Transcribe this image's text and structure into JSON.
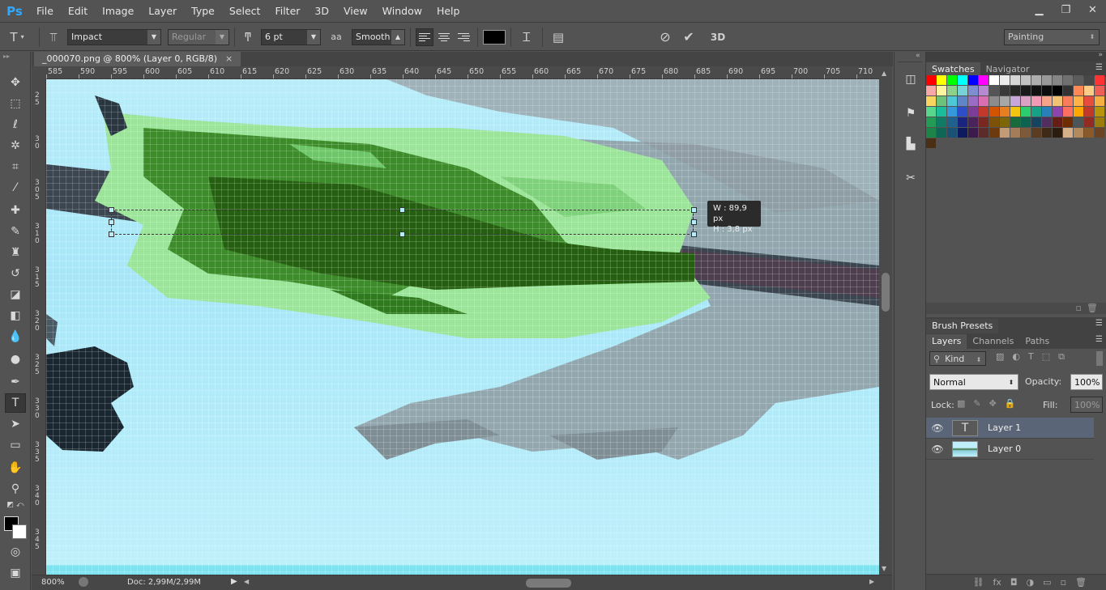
{
  "menu": {
    "logo": "Ps",
    "items": [
      "File",
      "Edit",
      "Image",
      "Layer",
      "Type",
      "Select",
      "Filter",
      "3D",
      "View",
      "Window",
      "Help"
    ]
  },
  "window_controls": [
    "minimize-icon",
    "restore-icon",
    "close-icon"
  ],
  "options": {
    "font_family": "Impact",
    "font_style": "Regular",
    "font_size": "6 pt",
    "anti_alias_icon": "aa",
    "anti_alias": "Smooth",
    "threed_label": "3D",
    "workspace": "Painting"
  },
  "document": {
    "tab_title": "_000070.png @ 800% (Layer 0, RGB/8)",
    "close": "×",
    "ruler_top_labels": [
      "585",
      "590",
      "595",
      "600",
      "605",
      "610",
      "615",
      "620",
      "625",
      "630",
      "635",
      "640",
      "645",
      "650",
      "655",
      "660",
      "665",
      "670",
      "675",
      "680",
      "685",
      "690",
      "695",
      "700",
      "705",
      "710"
    ],
    "ruler_left_labels": [
      "25",
      "30",
      "305",
      "310",
      "315",
      "320",
      "325",
      "330",
      "335",
      "340",
      "345"
    ],
    "transform_info": {
      "w": "W :  89,9 px",
      "h": "H :   3,8 px"
    }
  },
  "status": {
    "zoom": "800%",
    "doc_info": "Doc: 2,99M/2,99M"
  },
  "swatches_panel": {
    "tabs": [
      "Swatches",
      "Navigator"
    ],
    "colors": [
      "#ff0000",
      "#ffff00",
      "#00ff00",
      "#00ffff",
      "#0000ff",
      "#ff00ff",
      "#ffffff",
      "#ebebeb",
      "#d6d6d6",
      "#c2c2c2",
      "#adadad",
      "#999999",
      "#858585",
      "#707070",
      "#5c5c5c",
      "#474747",
      "#ff3333",
      "#f9a8a8",
      "#fff59e",
      "#8ed18a",
      "#77d1d6",
      "#7e8fd1",
      "#b58ad1",
      "#555555",
      "#3a3a3a",
      "#262626",
      "#1a1a1a",
      "#111111",
      "#0d0d0d",
      "#000000",
      "#333333",
      "#ff8855",
      "#ffcc88",
      "#ee5f55",
      "#f7d55e",
      "#6cc27a",
      "#4dc7d3",
      "#5f84c7",
      "#9b6cc3",
      "#d96fb0",
      "#8c8c8c",
      "#a7a7a7",
      "#c5a8d8",
      "#d9a2c4",
      "#f09ab5",
      "#f7a387",
      "#f1c274",
      "#fa7d5b",
      "#ffb347",
      "#e74c3c",
      "#f5b041",
      "#58d68d",
      "#1abc9c",
      "#3498db",
      "#2e4ec9",
      "#7d3c98",
      "#c0392b",
      "#d35400",
      "#e67e22",
      "#f1c40f",
      "#2ecc71",
      "#16a085",
      "#2980b9",
      "#8e44ad",
      "#ff6f61",
      "#ffa600",
      "#c0392b",
      "#b7950b",
      "#239b56",
      "#117a65",
      "#1f618d",
      "#1a237e",
      "#4a235a",
      "#78281f",
      "#7e5109",
      "#7d6608",
      "#186a3b",
      "#0e6251",
      "#154360",
      "#512e5f",
      "#641e16",
      "#6e2c00",
      "#4d5656",
      "#922b21",
      "#9a7d0a",
      "#1d8348",
      "#0e6655",
      "#1a5276",
      "#0d1b5e",
      "#3b1a4c",
      "#5b2c2a",
      "#6b3a0e",
      "#c39b77",
      "#a37d5a",
      "#7d5a3a",
      "#5a3c22",
      "#3f2a18",
      "#2c1c10",
      "#d6b08a",
      "#b38a5e",
      "#8b5a2b",
      "#6b4423",
      "#4a2e16"
    ]
  },
  "brush_presets": {
    "title": "Brush Presets"
  },
  "layers_panel": {
    "tabs": [
      "Layers",
      "Channels",
      "Paths"
    ],
    "filter_kind": "Kind",
    "blend_mode": "Normal",
    "opacity_label": "Opacity:",
    "opacity": "100%",
    "lock_label": "Lock:",
    "fill_label": "Fill:",
    "fill": "100%",
    "layers": [
      {
        "name": "Layer 1",
        "type": "text",
        "selected": true
      },
      {
        "name": "Layer 0",
        "type": "image",
        "selected": false
      }
    ]
  }
}
